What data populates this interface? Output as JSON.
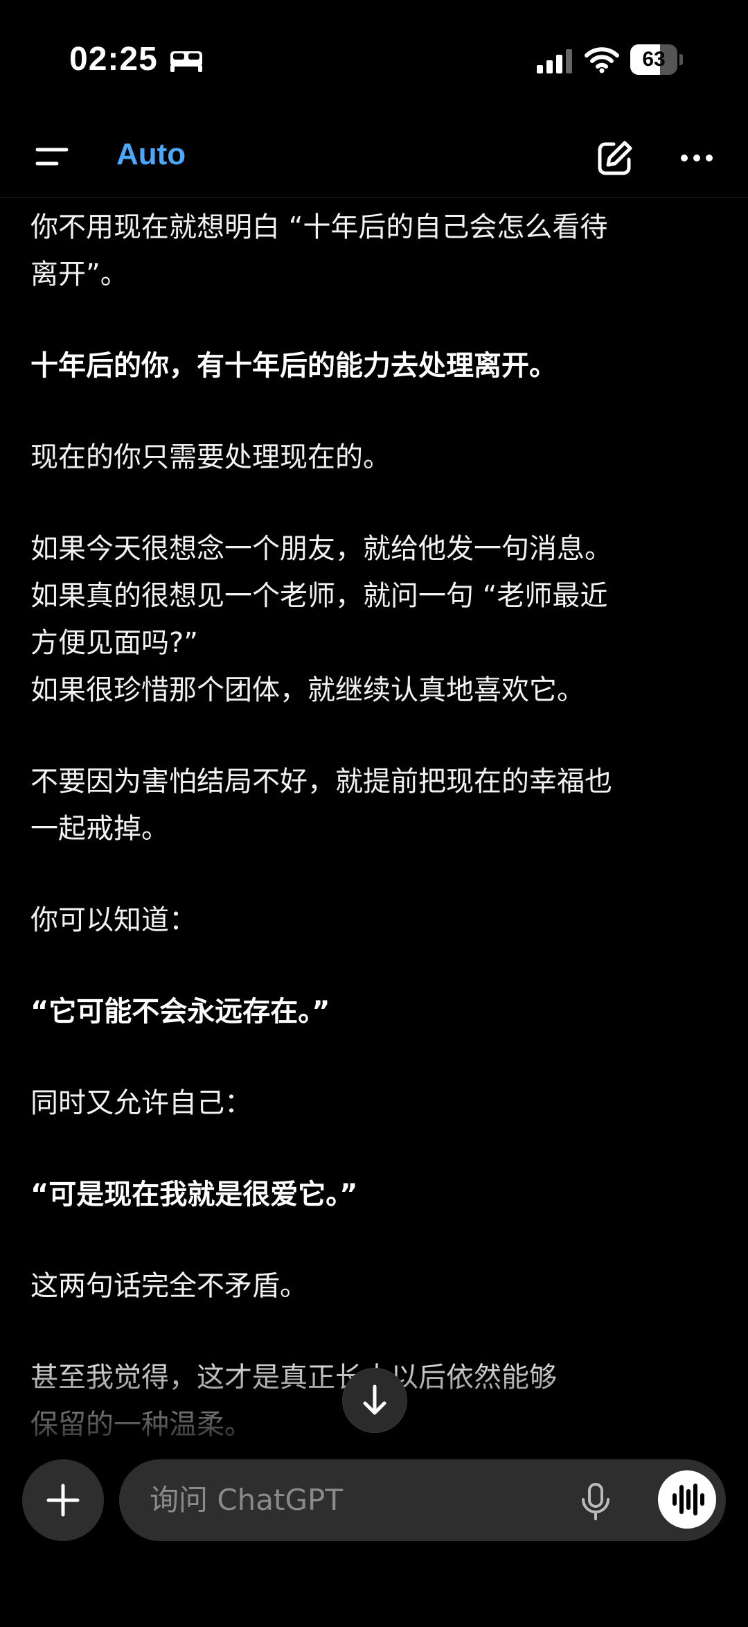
{
  "status_bar": {
    "time": "02:25",
    "battery": "63",
    "battery_level": 0.63
  },
  "header": {
    "model": "Auto"
  },
  "message": {
    "paragraphs": [
      {
        "lines": [
          "你不用现在就想明白 “十年后的自己会怎么看待",
          "离开”。"
        ],
        "bold": false
      },
      {
        "lines": [
          "十年后的你，有十年后的能力去处理离开。"
        ],
        "bold": true
      },
      {
        "lines": [
          "现在的你只需要处理现在的。"
        ],
        "bold": false
      },
      {
        "lines": [
          "如果今天很想念一个朋友，就给他发一句消息。",
          "如果真的很想见一个老师，就问一句 “老师最近",
          "方便见面吗?”",
          "如果很珍惜那个团体，就继续认真地喜欢它。"
        ],
        "bold": false
      },
      {
        "lines": [
          "不要因为害怕结局不好，就提前把现在的幸福也",
          "一起戒掉。"
        ],
        "bold": false
      },
      {
        "lines": [
          "你可以知道："
        ],
        "bold": false
      },
      {
        "lines": [
          "“它可能不会永远存在。”"
        ],
        "bold": true
      },
      {
        "lines": [
          "同时又允许自己："
        ],
        "bold": false
      },
      {
        "lines": [
          "“可是现在我就是很爱它。”"
        ],
        "bold": true
      },
      {
        "lines": [
          "这两句话完全不矛盾。"
        ],
        "bold": false
      },
      {
        "lines": [
          "甚至我觉得，这才是真正长大以后依然能够",
          "保留的一种温柔。"
        ],
        "bold": false
      }
    ]
  },
  "composer": {
    "placeholder": "询问 ChatGPT"
  },
  "icons": {
    "menu": "menu-icon",
    "new_chat": "edit-icon",
    "more": "more-icon",
    "scroll_down": "arrow-down-icon",
    "add": "plus-icon",
    "mic": "mic-icon",
    "voice": "voice-waveform-icon",
    "sleep": "bed-icon",
    "signal": "signal-icon",
    "wifi": "wifi-icon"
  },
  "colors": {
    "background": "#000000",
    "accent": "#4aa8ff",
    "surface": "#2e2e2e"
  }
}
